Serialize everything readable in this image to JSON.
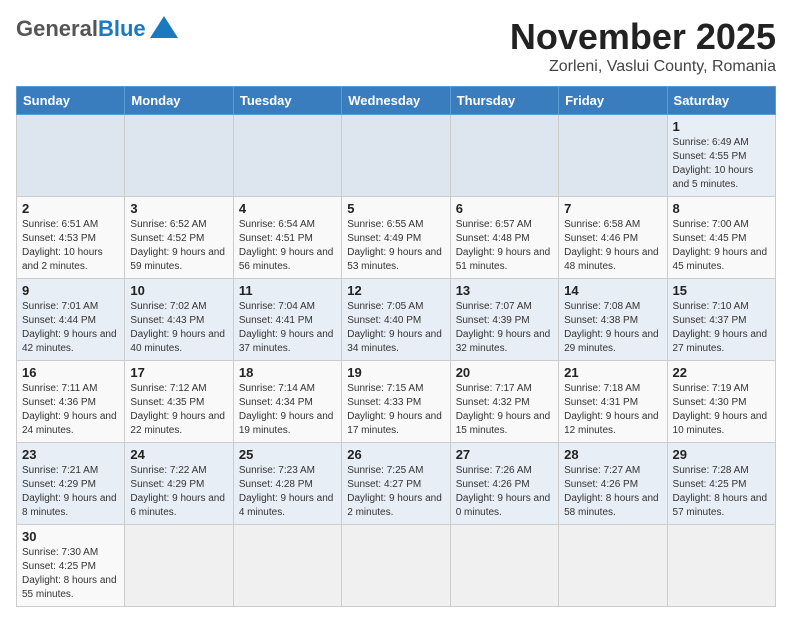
{
  "header": {
    "logo_general": "General",
    "logo_blue": "Blue",
    "month_title": "November 2025",
    "location": "Zorleni, Vaslui County, Romania"
  },
  "days_of_week": [
    "Sunday",
    "Monday",
    "Tuesday",
    "Wednesday",
    "Thursday",
    "Friday",
    "Saturday"
  ],
  "weeks": [
    [
      {
        "day": "",
        "info": ""
      },
      {
        "day": "",
        "info": ""
      },
      {
        "day": "",
        "info": ""
      },
      {
        "day": "",
        "info": ""
      },
      {
        "day": "",
        "info": ""
      },
      {
        "day": "",
        "info": ""
      },
      {
        "day": "1",
        "info": "Sunrise: 6:49 AM\nSunset: 4:55 PM\nDaylight: 10 hours and 5 minutes."
      }
    ],
    [
      {
        "day": "2",
        "info": "Sunrise: 6:51 AM\nSunset: 4:53 PM\nDaylight: 10 hours and 2 minutes."
      },
      {
        "day": "3",
        "info": "Sunrise: 6:52 AM\nSunset: 4:52 PM\nDaylight: 9 hours and 59 minutes."
      },
      {
        "day": "4",
        "info": "Sunrise: 6:54 AM\nSunset: 4:51 PM\nDaylight: 9 hours and 56 minutes."
      },
      {
        "day": "5",
        "info": "Sunrise: 6:55 AM\nSunset: 4:49 PM\nDaylight: 9 hours and 53 minutes."
      },
      {
        "day": "6",
        "info": "Sunrise: 6:57 AM\nSunset: 4:48 PM\nDaylight: 9 hours and 51 minutes."
      },
      {
        "day": "7",
        "info": "Sunrise: 6:58 AM\nSunset: 4:46 PM\nDaylight: 9 hours and 48 minutes."
      },
      {
        "day": "8",
        "info": "Sunrise: 7:00 AM\nSunset: 4:45 PM\nDaylight: 9 hours and 45 minutes."
      }
    ],
    [
      {
        "day": "9",
        "info": "Sunrise: 7:01 AM\nSunset: 4:44 PM\nDaylight: 9 hours and 42 minutes."
      },
      {
        "day": "10",
        "info": "Sunrise: 7:02 AM\nSunset: 4:43 PM\nDaylight: 9 hours and 40 minutes."
      },
      {
        "day": "11",
        "info": "Sunrise: 7:04 AM\nSunset: 4:41 PM\nDaylight: 9 hours and 37 minutes."
      },
      {
        "day": "12",
        "info": "Sunrise: 7:05 AM\nSunset: 4:40 PM\nDaylight: 9 hours and 34 minutes."
      },
      {
        "day": "13",
        "info": "Sunrise: 7:07 AM\nSunset: 4:39 PM\nDaylight: 9 hours and 32 minutes."
      },
      {
        "day": "14",
        "info": "Sunrise: 7:08 AM\nSunset: 4:38 PM\nDaylight: 9 hours and 29 minutes."
      },
      {
        "day": "15",
        "info": "Sunrise: 7:10 AM\nSunset: 4:37 PM\nDaylight: 9 hours and 27 minutes."
      }
    ],
    [
      {
        "day": "16",
        "info": "Sunrise: 7:11 AM\nSunset: 4:36 PM\nDaylight: 9 hours and 24 minutes."
      },
      {
        "day": "17",
        "info": "Sunrise: 7:12 AM\nSunset: 4:35 PM\nDaylight: 9 hours and 22 minutes."
      },
      {
        "day": "18",
        "info": "Sunrise: 7:14 AM\nSunset: 4:34 PM\nDaylight: 9 hours and 19 minutes."
      },
      {
        "day": "19",
        "info": "Sunrise: 7:15 AM\nSunset: 4:33 PM\nDaylight: 9 hours and 17 minutes."
      },
      {
        "day": "20",
        "info": "Sunrise: 7:17 AM\nSunset: 4:32 PM\nDaylight: 9 hours and 15 minutes."
      },
      {
        "day": "21",
        "info": "Sunrise: 7:18 AM\nSunset: 4:31 PM\nDaylight: 9 hours and 12 minutes."
      },
      {
        "day": "22",
        "info": "Sunrise: 7:19 AM\nSunset: 4:30 PM\nDaylight: 9 hours and 10 minutes."
      }
    ],
    [
      {
        "day": "23",
        "info": "Sunrise: 7:21 AM\nSunset: 4:29 PM\nDaylight: 9 hours and 8 minutes."
      },
      {
        "day": "24",
        "info": "Sunrise: 7:22 AM\nSunset: 4:29 PM\nDaylight: 9 hours and 6 minutes."
      },
      {
        "day": "25",
        "info": "Sunrise: 7:23 AM\nSunset: 4:28 PM\nDaylight: 9 hours and 4 minutes."
      },
      {
        "day": "26",
        "info": "Sunrise: 7:25 AM\nSunset: 4:27 PM\nDaylight: 9 hours and 2 minutes."
      },
      {
        "day": "27",
        "info": "Sunrise: 7:26 AM\nSunset: 4:26 PM\nDaylight: 9 hours and 0 minutes."
      },
      {
        "day": "28",
        "info": "Sunrise: 7:27 AM\nSunset: 4:26 PM\nDaylight: 8 hours and 58 minutes."
      },
      {
        "day": "29",
        "info": "Sunrise: 7:28 AM\nSunset: 4:25 PM\nDaylight: 8 hours and 57 minutes."
      }
    ],
    [
      {
        "day": "30",
        "info": "Sunrise: 7:30 AM\nSunset: 4:25 PM\nDaylight: 8 hours and 55 minutes."
      },
      {
        "day": "",
        "info": ""
      },
      {
        "day": "",
        "info": ""
      },
      {
        "day": "",
        "info": ""
      },
      {
        "day": "",
        "info": ""
      },
      {
        "day": "",
        "info": ""
      },
      {
        "day": "",
        "info": ""
      }
    ]
  ]
}
